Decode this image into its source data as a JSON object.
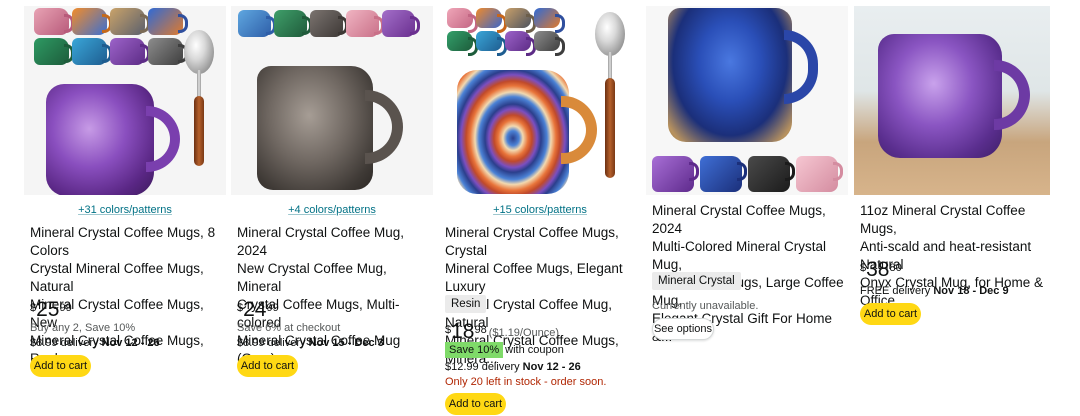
{
  "products": [
    {
      "colors_link": "+31 colors/patterns",
      "title_lines": [
        "Mineral Crystal Coffee Mugs, 8 Colors",
        "Crystal Mineral Coffee Mugs, Natural",
        "Mineral Crystal Coffee Mugs, New",
        "Mineral Crystal Coffee Mugs, Real..."
      ],
      "price": {
        "symbol": "$",
        "whole": "25",
        "fraction": "99"
      },
      "promo": "Buy any 2, Save 10%",
      "delivery": {
        "prefix": "$8.99 delivery",
        "dates": "Nov 12 - 26"
      },
      "cart_label": "Add to cart",
      "image": {
        "main_color": "#7b3fa0",
        "handle": "spoon"
      }
    },
    {
      "colors_link": "+4 colors/patterns",
      "title_lines": [
        "Mineral Crystal Coffee Mug, 2024",
        "New Crystal Coffee Mug, Mineral",
        "Crystal Coffee Mugs, Multi-colored",
        "Mineral Crystal Coffee Mug (Grey)"
      ],
      "price": {
        "symbol": "$",
        "whole": "24",
        "fraction": "99"
      },
      "promo": "Save 6% at checkout",
      "delivery": {
        "prefix": "$8.99 delivery",
        "dates": "Nov 15 - Dec 3"
      },
      "cart_label": "Add to cart",
      "image": {
        "main_color": "#5b5450"
      }
    },
    {
      "colors_link": "+15 colors/patterns",
      "title_lines": [
        "Mineral Crystal Coffee Mugs, Crystal",
        "Mineral Coffee Mugs, Elegant Luxury",
        "Mineral Crystal Coffee Mug, Natural",
        "Mineral Crystal Coffee Mugs, Minera..."
      ],
      "material_badge": "Resin",
      "price": {
        "symbol": "$",
        "whole": "18",
        "fraction": "98",
        "unit": "($1.19/Ounce)"
      },
      "save_badge": "Save 10%",
      "save_note": "with coupon",
      "delivery": {
        "prefix": "$12.99 delivery",
        "dates": "Nov 12 - 26"
      },
      "stock": "Only 20 left in stock - order soon.",
      "cart_label": "Add to cart",
      "image": {
        "main_color": "#e8743a",
        "handle": "spoon"
      }
    },
    {
      "title_lines": [
        "Mineral Crystal Coffee Mugs, 2024",
        "Multi-Colored Mineral Crystal Mug,",
        "Bulk Coffee Mugs, Large Coffee Mug,",
        "Elegant Crystal Gift For Home &..."
      ],
      "material_badge": "Mineral Crystal",
      "availability": "Currently unavailable.",
      "options_label": "See options",
      "image": {
        "main_color": "#1e3d9a"
      }
    },
    {
      "title_lines": [
        "11oz Mineral Crystal Coffee Mugs,",
        "Anti-scald and heat-resistant Natural",
        "Onyx Crystal Mug, for Home & Office"
      ],
      "price": {
        "symbol": "$",
        "whole": "38",
        "fraction": "80"
      },
      "delivery": {
        "prefix": "FREE delivery",
        "dates": "Nov 18 - Dec 9"
      },
      "cart_label": "Add to cart",
      "image": {
        "main_color": "#6a3a98"
      }
    }
  ],
  "colors": {
    "link": "#007185",
    "cart_button": "#ffd814",
    "save_badge": "#7fda69",
    "stock_warning": "#b12704",
    "badge_bg": "#ebebeb"
  }
}
